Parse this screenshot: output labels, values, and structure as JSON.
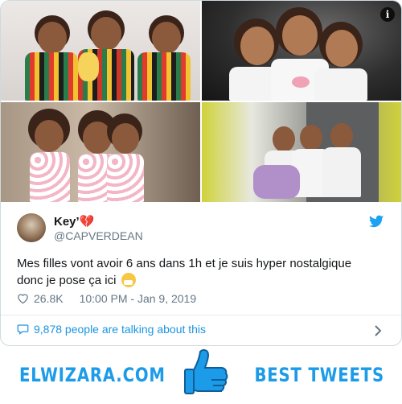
{
  "tweet": {
    "display_name": "Key’💔",
    "handle": "@CAPVERDEAN",
    "text_line1": "Mes filles vont avoir 6 ans dans 1h et je suis hyper nostalgique",
    "text_line2": "donc je pose ça ici",
    "likes": "26.8K",
    "timestamp": "10:00 PM - Jan 9, 2019",
    "talking": "9,878 people are talking about this",
    "info_glyph": "i"
  },
  "banner": {
    "left_text": "ELWIZARA.COM",
    "right_text": "BEST TWEETS"
  },
  "colors": {
    "twitter_blue": "#1da1f2",
    "link_blue": "#1b95e0",
    "banner_blue": "#1c9be8",
    "muted_gray": "#657786"
  },
  "icons": [
    "info-icon",
    "twitter-bird-icon",
    "heart-icon",
    "speech-bubble-icon",
    "chevron-right-icon",
    "thumbs-up-icon",
    "sneeze-emoji-icon"
  ]
}
